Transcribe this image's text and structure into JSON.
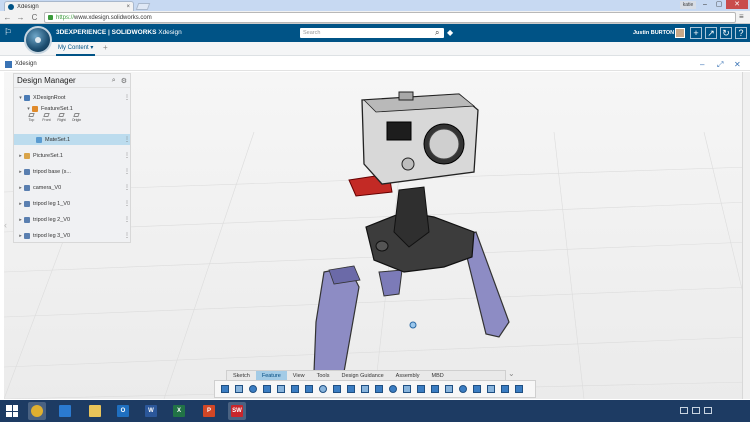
{
  "browser": {
    "tab_title": "Xdesign",
    "tab_close": "×",
    "user_badge": "katie",
    "url_protocol": "https://",
    "url_host": "www.xdesign.solidworks.com",
    "menu_icon": "≡",
    "win_min": "–",
    "win_max": "▢",
    "win_close": "✕",
    "back": "←",
    "forward": "→",
    "reload": "C"
  },
  "topbar": {
    "brand_bold": "3DEXPERIENCE | SOLIDWORKS",
    "brand_light": " Xdesign",
    "search_placeholder": "Search",
    "search_icon": "⌕",
    "tag_icon": "◆",
    "user_name": "Justin BURTON",
    "buttons": [
      "+",
      "↗",
      "↻",
      "⌂",
      "?"
    ]
  },
  "dashboard": {
    "tab": "My Content ▾",
    "add": "+"
  },
  "app": {
    "title": "Xdesign",
    "icons": [
      "–",
      "⤢",
      "✕"
    ]
  },
  "design_manager": {
    "title": "Design Manager",
    "search_icon": "⌕",
    "gear_icon": "⚙",
    "rows": [
      {
        "caret": "▾",
        "label": "XDesignRoot",
        "more": "⋮",
        "color": "#4a7bb5"
      },
      {
        "caret": "▾",
        "label": "FeatureSet.1",
        "more": "",
        "color": "#e08a2a"
      },
      {
        "caret": "",
        "label": "MateSet.1",
        "more": "⋮",
        "color": "#5a9bd0"
      },
      {
        "caret": "▸",
        "label": "PictureSet.1",
        "more": "⋮",
        "color": "#d9a44a"
      },
      {
        "caret": "▸",
        "label": "tripod base (s...",
        "more": "⋮",
        "color": "#5a7fb0"
      },
      {
        "caret": "▸",
        "label": "camera_V0",
        "more": "⋮",
        "color": "#5a7fb0"
      },
      {
        "caret": "▸",
        "label": "tripod leg 1_V0",
        "more": "⋮",
        "color": "#5a7fb0"
      },
      {
        "caret": "▸",
        "label": "tripod leg 2_V0",
        "more": "⋮",
        "color": "#5a7fb0"
      },
      {
        "caret": "▸",
        "label": "tripod leg 3_V0",
        "more": "⋮",
        "color": "#5a7fb0"
      }
    ],
    "planes": [
      "Top",
      "Front",
      "Right",
      "Origin"
    ]
  },
  "command_tabs": [
    {
      "label": "Sketch",
      "active": false
    },
    {
      "label": "Feature",
      "active": true
    },
    {
      "label": "View",
      "active": false
    },
    {
      "label": "Tools",
      "active": false
    },
    {
      "label": "Design Guidance",
      "active": false
    },
    {
      "label": "Assembly",
      "active": false
    },
    {
      "label": "MBD",
      "active": false
    }
  ],
  "command_more": "⌄",
  "taskbar": {
    "apps": [
      "",
      "",
      "",
      "",
      "O",
      "W",
      "X",
      "P",
      "SW"
    ]
  },
  "colors": {
    "brand_blue": "#005386",
    "selected_row": "#bcdcee",
    "active_tab": "#a3cbe6",
    "taskbar": "#1d3b63"
  }
}
